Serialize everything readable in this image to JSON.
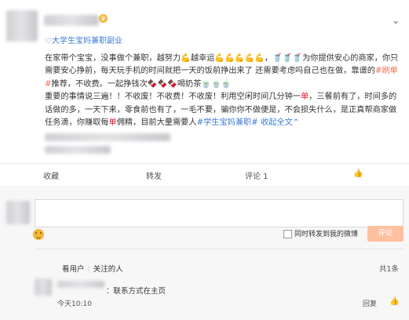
{
  "post": {
    "topic_tag": "大学生宝妈兼职副业",
    "segments": [
      {
        "t": "在家带个宝宝，没事做个兼职，越努力💪越幸运💪💪💪💪💪，🥤🥤🥤为你提供安心的商家，你只需要安心挣前，每天玩手机的时间就把一天的饭前挣出来了 还需要考虑吗自己也在做，靠谱的",
        "c": ""
      },
      {
        "t": "#刷单#",
        "c": "link"
      },
      {
        "t": "推荐，不收费。一起挣钱次🍫🍫🍫喝奶茶🍵🍵🍵",
        "c": ""
      },
      {
        "t": "\n重要的事情说三遍！！不收废！不收费！不收废！利用空闲时间几分钟一",
        "c": ""
      },
      {
        "t": "单",
        "c": "red"
      },
      {
        "t": "，三餐前有了，时间多的话做的多，一天下来，零食前也有了，一毛不要，骗你你不做便是，不会损失什么，是正真帮商家做任务滴，你赚取每",
        "c": ""
      },
      {
        "t": "单",
        "c": "red"
      },
      {
        "t": "佣精，目前大量需要人",
        "c": ""
      },
      {
        "t": "#学生宝妈兼职#",
        "c": "blue"
      },
      {
        "t": " 收起全文",
        "c": "blue"
      },
      {
        "t": "⌃",
        "c": "blue"
      }
    ]
  },
  "actions": {
    "favorite": "收藏",
    "repost": "转发",
    "comment": "评论 1",
    "like_icon": "thumb-up-icon"
  },
  "composer": {
    "repost_checkbox_label": "同时转发到我的微博",
    "submit_label": "评论"
  },
  "comments": {
    "filter_all": "看用户",
    "filter_follow": "关注的人",
    "total": "共1条",
    "items": [
      {
        "text": "：联系方式在主页",
        "time": "今天10:10",
        "reply": "回复"
      }
    ]
  }
}
